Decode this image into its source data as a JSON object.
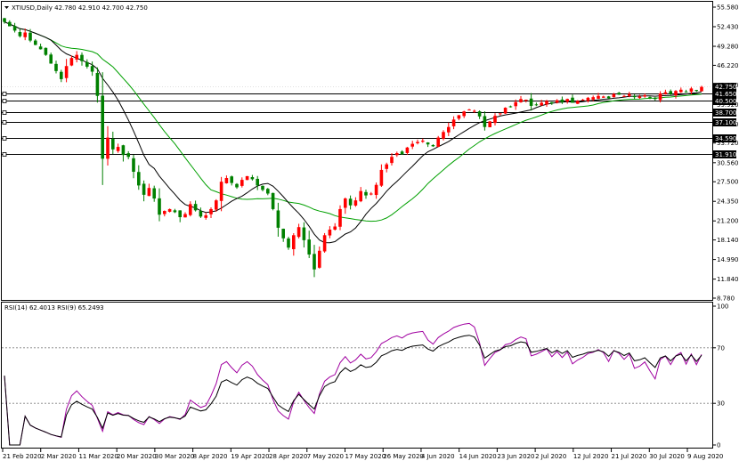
{
  "chart_title": "XTIUSD,Daily  42.780 42.910 42.700 42.750",
  "colors": {
    "background": "#ffffff",
    "frame": "#000000",
    "bull": "#ff0000",
    "bear": "#008000",
    "ma_fast": "#000000",
    "ma_slow": "#00a000",
    "rsi14": "#000000",
    "rsi9": "#a000a0",
    "level_line": "#000000",
    "label_bg": "#000000",
    "current_label_bg": "#ff0000"
  },
  "price_axis": {
    "ticks": [
      "55.580",
      "52.430",
      "49.280",
      "46.220",
      "43.070",
      "39.920",
      "36.770",
      "33.720",
      "30.560",
      "27.500",
      "24.350",
      "21.200",
      "18.140",
      "14.990",
      "11.840",
      "8.780"
    ]
  },
  "levels": [
    "41.650",
    "40.500",
    "38.700",
    "37.100",
    "34.590",
    "31.910"
  ],
  "current_price_label": "42.750",
  "date_labels": [
    "21 Feb 2020",
    "2 Mar 2020",
    "11 Mar 2020",
    "20 Mar 2020",
    "30 Mar 2020",
    "8 Apr 2020",
    "19 Apr 2020",
    "28 Apr 2020",
    "7 May 2020",
    "17 May 2020",
    "26 May 2020",
    "4 Jun 2020",
    "14 Jun 2020",
    "23 Jun 2020",
    "2 Jul 2020",
    "12 Jul 2020",
    "21 Jul 2020",
    "30 Jul 2020",
    "9 Aug 2020"
  ],
  "rsi_panel": {
    "title": "RSI(14) 62.4013  RSI(9) 65.2493",
    "ticks": [
      "100",
      "70",
      "30",
      "0"
    ],
    "levels": [
      70,
      30
    ]
  },
  "chart_data": {
    "type": "candlestick",
    "title": "XTIUSD,Daily  42.780 42.910 42.700 42.750",
    "ylim": [
      8.78,
      55.58
    ],
    "ohlc_close": [
      53.2,
      52.5,
      51.8,
      50.9,
      51.5,
      50.2,
      49.5,
      48.8,
      47.9,
      46.5,
      45.3,
      44.0,
      46.1,
      47.4,
      47.9,
      46.9,
      46.0,
      45.2,
      41.3,
      31.2,
      34.6,
      32.7,
      33.1,
      31.8,
      31.5,
      29.1,
      26.9,
      25.4,
      26.5,
      24.8,
      22.2,
      22.8,
      23.1,
      22.6,
      21.8,
      22.3,
      23.9,
      22.9,
      21.9,
      22.1,
      23.1,
      24.5,
      27.5,
      28.1,
      27.3,
      26.6,
      27.8,
      28.4,
      27.9,
      26.9,
      26.2,
      25.6,
      23.1,
      20.1,
      18.4,
      16.9,
      18.9,
      20.2,
      18.1,
      15.8,
      13.4,
      16.4,
      18.9,
      19.8,
      20.3,
      23.1,
      24.8,
      23.7,
      24.5,
      26.0,
      25.3,
      25.6,
      27.0,
      29.4,
      30.3,
      31.5,
      32.1,
      31.9,
      33.0,
      33.6,
      33.9,
      34.1,
      33.5,
      33.2,
      34.6,
      35.5,
      36.3,
      37.5,
      38.2,
      38.8,
      39.1,
      38.9,
      38.0,
      36.3,
      37.2,
      38.1,
      38.5,
      39.4,
      39.6,
      40.3,
      40.8,
      40.7,
      39.7,
      39.9,
      40.2,
      40.5,
      40.1,
      40.6,
      40.3,
      40.8,
      40.2,
      40.5,
      40.7,
      41.0,
      41.1,
      41.3,
      41.2,
      40.9,
      41.6,
      41.5,
      41.3,
      41.6,
      41.1,
      41.2,
      41.4,
      41.1,
      40.8,
      41.7,
      41.9,
      41.6,
      42.1,
      42.3,
      41.9,
      42.5,
      42.1,
      42.75
    ],
    "series": [
      {
        "name": "RSI(14)",
        "last": 62.4013
      },
      {
        "name": "RSI(9)",
        "last": 65.2493
      }
    ]
  }
}
